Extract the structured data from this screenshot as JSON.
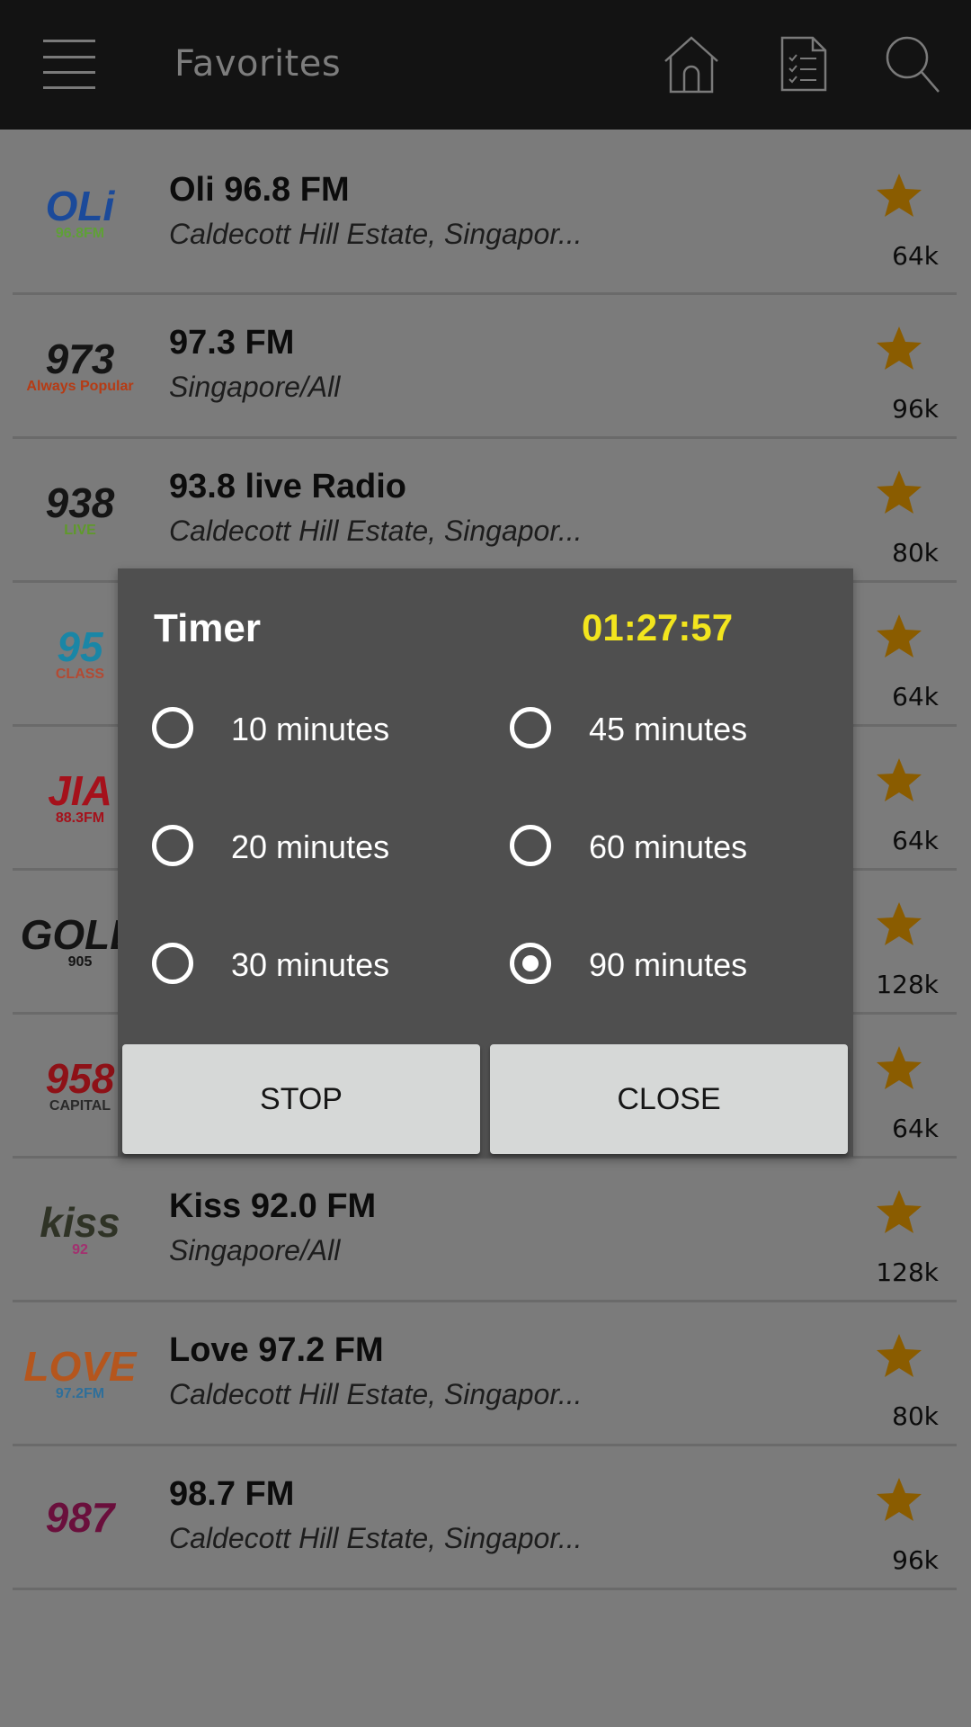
{
  "header": {
    "title": "Favorites",
    "icons": [
      "menu-icon",
      "home-icon",
      "checklist-icon",
      "search-icon"
    ]
  },
  "stations": [
    {
      "name": "Oli 96.8 FM",
      "location": "Caldecott Hill Estate, Singapor...",
      "bitrate": "64k",
      "logo_text": "OLi",
      "logo_sub": "96.8FM",
      "logo_color": "#1b4a9a",
      "logo_accent": "#5fa037",
      "favorite": true
    },
    {
      "name": "97.3 FM",
      "location": "Singapore/All",
      "bitrate": "96k",
      "logo_text": "973",
      "logo_sub": "Always Popular",
      "logo_color": "#151515",
      "logo_accent": "#b63b14",
      "favorite": true
    },
    {
      "name": "93.8 live Radio",
      "location": "Caldecott Hill Estate, Singapor...",
      "bitrate": "80k",
      "logo_text": "938",
      "logo_sub": "LIVE",
      "logo_color": "#151515",
      "logo_accent": "#5f9a2a",
      "favorite": true
    },
    {
      "name": "",
      "location": "",
      "bitrate": "64k",
      "logo_text": "95",
      "logo_sub": "CLASS",
      "logo_color": "#1a86a6",
      "logo_accent": "#b44a33",
      "favorite": true
    },
    {
      "name": "",
      "location": "",
      "bitrate": "64k",
      "logo_text": "JIA",
      "logo_sub": "88.3FM",
      "logo_color": "#a5111b",
      "logo_accent": "#a5111b",
      "favorite": true
    },
    {
      "name": "",
      "location": "",
      "bitrate": "128k",
      "logo_text": "GOLD",
      "logo_sub": "905",
      "logo_color": "#141414",
      "logo_accent": "#141414",
      "favorite": true
    },
    {
      "name": "",
      "location": "",
      "bitrate": "64k",
      "logo_text": "958",
      "logo_sub": "CAPITAL",
      "logo_color": "#8e1117",
      "logo_accent": "#2a2a2a",
      "favorite": true
    },
    {
      "name": "Kiss 92.0 FM",
      "location": "Singapore/All",
      "bitrate": "128k",
      "logo_text": "kiss",
      "logo_sub": "92",
      "logo_color": "#2f3326",
      "logo_accent": "#a3306f",
      "favorite": true
    },
    {
      "name": "Love 97.2 FM",
      "location": "Caldecott Hill Estate, Singapor...",
      "bitrate": "80k",
      "logo_text": "LOVE",
      "logo_sub": "97.2FM",
      "logo_color": "#b5561d",
      "logo_accent": "#2f6f9a",
      "favorite": true
    },
    {
      "name": "98.7 FM",
      "location": "Caldecott Hill Estate, Singapor...",
      "bitrate": "96k",
      "logo_text": "987",
      "logo_sub": "",
      "logo_color": "#6a0f3c",
      "logo_accent": "#0a0a0a",
      "favorite": true
    }
  ],
  "timer_dialog": {
    "title": "Timer",
    "countdown": "01:27:57",
    "countdown_color": "#f2e51e",
    "options": [
      {
        "label": "10 minutes",
        "selected": false
      },
      {
        "label": "20 minutes",
        "selected": false
      },
      {
        "label": "30 minutes",
        "selected": false
      },
      {
        "label": "45 minutes",
        "selected": false
      },
      {
        "label": "60 minutes",
        "selected": false
      },
      {
        "label": "90 minutes",
        "selected": true
      }
    ],
    "buttons": {
      "stop": "STOP",
      "close": "CLOSE"
    }
  },
  "colors": {
    "header_bg": "#131313",
    "list_bg_dimmed": "#7b7b7b",
    "dialog_bg": "#4f4f4f",
    "star": "#8a5c00",
    "button_bg": "#d6d8d7"
  }
}
